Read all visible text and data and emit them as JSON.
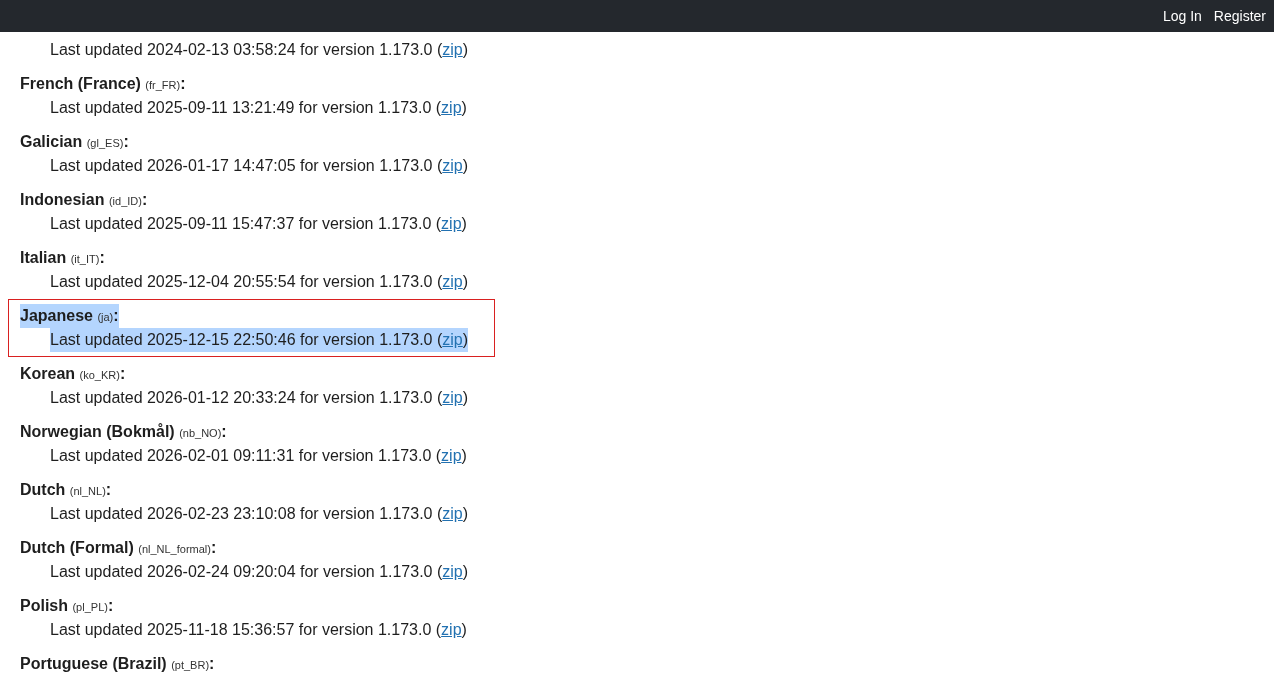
{
  "nav": {
    "links": [
      "Log In",
      "Register"
    ]
  },
  "entries": [
    {
      "updated": "Last updated 2024-02-13 03:58:24 for version 1.173.0 (",
      "link": "zip",
      "after_link": ")",
      "selected": false
    },
    {
      "heading": "French (France) *(fr_FR)*:",
      "updated": "Last updated 2025-09-11 13:21:49 for version 1.173.0 (",
      "link": "zip",
      "after_link": ")",
      "selected": false
    },
    {
      "heading": "Galician *(gl_ES)*:",
      "updated": "Last updated 2026-01-17 14:47:05 for version 1.173.0 (",
      "link": "zip",
      "after_link": ")",
      "selected": false
    },
    {
      "heading": "Indonesian *(id_ID)*:",
      "updated": "Last updated 2025-09-11 15:47:37 for version 1.173.0 (",
      "link": "zip",
      "after_link": ")",
      "selected": false
    },
    {
      "heading": "Italian *(it_IT)*:",
      "updated": "Last updated 2025-12-04 20:55:54 for version 1.173.0 (",
      "link": "zip",
      "after_link": ")",
      "selected": false
    },
    {
      "heading": "Japanese *(ja)*:",
      "updated": "Last updated 2025-12-15 22:50:46 for version 1.173.0 (",
      "link": "zip",
      "after_link": ")",
      "selected": true
    },
    {
      "heading": "Korean *(ko_KR)*:",
      "updated": "Last updated 2026-01-12 20:33:24 for version 1.173.0 (",
      "link": "zip",
      "after_link": ")",
      "selected": false
    },
    {
      "heading": "Norwegian (Bokmål) *(nb_NO)*:",
      "updated": "Last updated 2026-02-01 09:11:31 for version 1.173.0 (",
      "link": "zip",
      "after_link": ")",
      "selected": false
    },
    {
      "heading": "Dutch *(nl_NL)*:",
      "updated": "Last updated 2026-02-23 23:10:08 for version 1.173.0 (",
      "link": "zip",
      "after_link": ")",
      "selected": false
    },
    {
      "heading": "Dutch (Formal) *(nl_NL_formal)*:",
      "updated": "Last updated 2026-02-24 09:20:04 for version 1.173.0 (",
      "link": "zip",
      "after_link": ")",
      "selected": false
    },
    {
      "heading": "Polish *(pl_PL)*:",
      "updated": "Last updated 2025-11-18 15:36:57 for version 1.173.0 (",
      "link": "zip",
      "after_link": ")",
      "selected": false
    },
    {
      "heading": "Portuguese (Brazil) *(pt_BR)*:",
      "selected": false
    }
  ]
}
